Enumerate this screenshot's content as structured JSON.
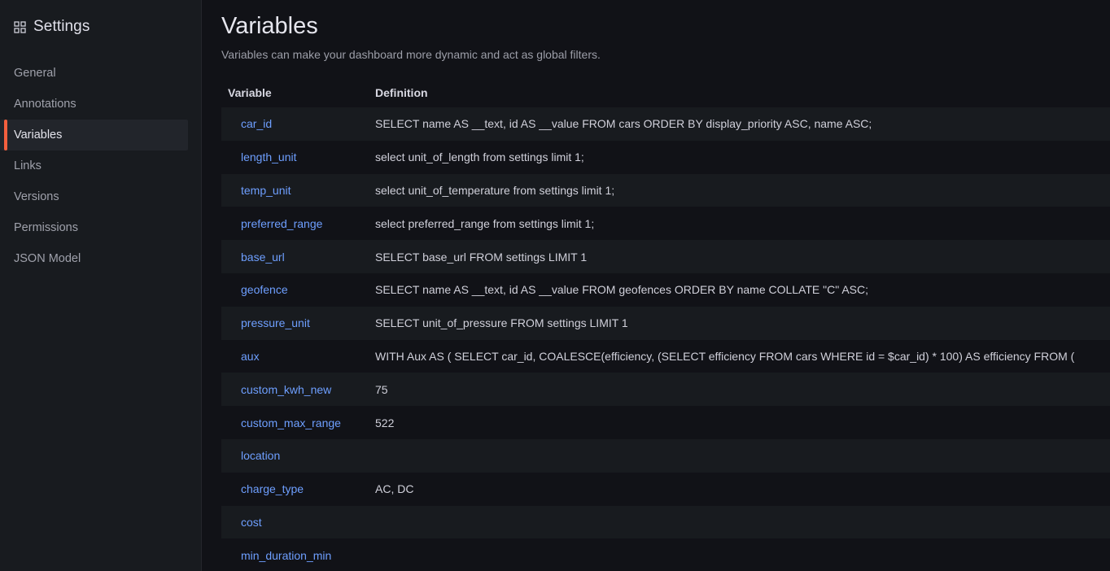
{
  "sidebar": {
    "title": "Settings",
    "items": [
      {
        "label": "General",
        "active": false
      },
      {
        "label": "Annotations",
        "active": false
      },
      {
        "label": "Variables",
        "active": true
      },
      {
        "label": "Links",
        "active": false
      },
      {
        "label": "Versions",
        "active": false
      },
      {
        "label": "Permissions",
        "active": false
      },
      {
        "label": "JSON Model",
        "active": false
      }
    ]
  },
  "main": {
    "title": "Variables",
    "subtitle": "Variables can make your dashboard more dynamic and act as global filters.",
    "table": {
      "headers": {
        "variable": "Variable",
        "definition": "Definition"
      },
      "rows": [
        {
          "name": "car_id",
          "definition": "SELECT name AS __text, id AS __value FROM cars ORDER BY display_priority ASC, name ASC;"
        },
        {
          "name": "length_unit",
          "definition": "select unit_of_length from settings limit 1;"
        },
        {
          "name": "temp_unit",
          "definition": "select unit_of_temperature from settings limit 1;"
        },
        {
          "name": "preferred_range",
          "definition": "select preferred_range from settings limit 1;"
        },
        {
          "name": "base_url",
          "definition": "SELECT base_url FROM settings LIMIT 1"
        },
        {
          "name": "geofence",
          "definition": "SELECT name AS __text, id AS __value FROM geofences ORDER BY name COLLATE \"C\" ASC;"
        },
        {
          "name": "pressure_unit",
          "definition": "SELECT unit_of_pressure FROM settings LIMIT 1"
        },
        {
          "name": "aux",
          "definition": "WITH Aux AS ( SELECT car_id, COALESCE(efficiency, (SELECT efficiency FROM cars WHERE id = $car_id) * 100) AS efficiency FROM ("
        },
        {
          "name": "custom_kwh_new",
          "definition": "75"
        },
        {
          "name": "custom_max_range",
          "definition": "522"
        },
        {
          "name": "location",
          "definition": ""
        },
        {
          "name": "charge_type",
          "definition": "AC, DC"
        },
        {
          "name": "cost",
          "definition": ""
        },
        {
          "name": "min_duration_min",
          "definition": ""
        }
      ]
    }
  },
  "colors": {
    "accent": "#f55f3e",
    "link": "#6e9fff",
    "background": "#111217",
    "sidebar": "#181b1f"
  },
  "icons": {
    "sidebar_header": "grid-icon"
  }
}
